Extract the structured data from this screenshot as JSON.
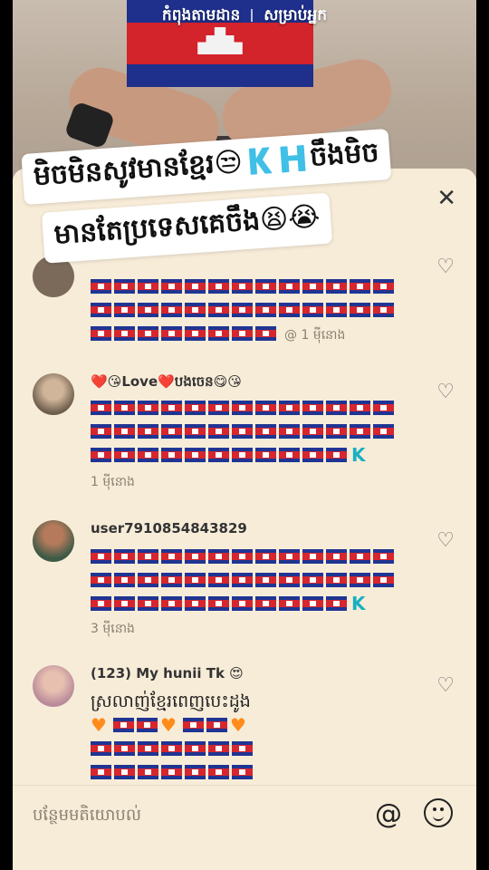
{
  "header": {
    "tab_following": "កំពុងតាមដាន",
    "tab_for_you": "សម្រាប់អ្នក"
  },
  "sticker": {
    "line1": "មិចមិនសូវមានខ្មែរ😒🇰🇭ចឹងមិច",
    "line2": "មានតែប្រទេសគេចឹង😫😭"
  },
  "comments": [
    {
      "username": "",
      "flag_rows": [
        13,
        13,
        8
      ],
      "time": "@ 1 មុីនោង"
    },
    {
      "username": "❤️😘Love❤️បងចេន😋😘",
      "flag_rows": [
        13,
        13,
        11
      ],
      "suffix": "K",
      "time": "1 មុីនោង"
    },
    {
      "username": "user7910854843829",
      "flag_rows": [
        13,
        13,
        11
      ],
      "suffix": "K",
      "time": "3 មុីនោង"
    },
    {
      "username": "(123) My hunii Tk 😍",
      "text": "ស្រលាញ់ខ្មែរពេញបេះដូង"
    }
  ],
  "input": {
    "placeholder": "បន្ថែមមតិយោបល់",
    "mention_symbol": "@"
  },
  "colors": {
    "panel_bg": "#f7ecd8",
    "flag_blue": "#1f3594",
    "flag_red": "#d6262e",
    "k_color": "#18b0c2"
  },
  "icons": [
    "close-icon",
    "heart-icon",
    "mention-icon",
    "emoji-icon"
  ]
}
